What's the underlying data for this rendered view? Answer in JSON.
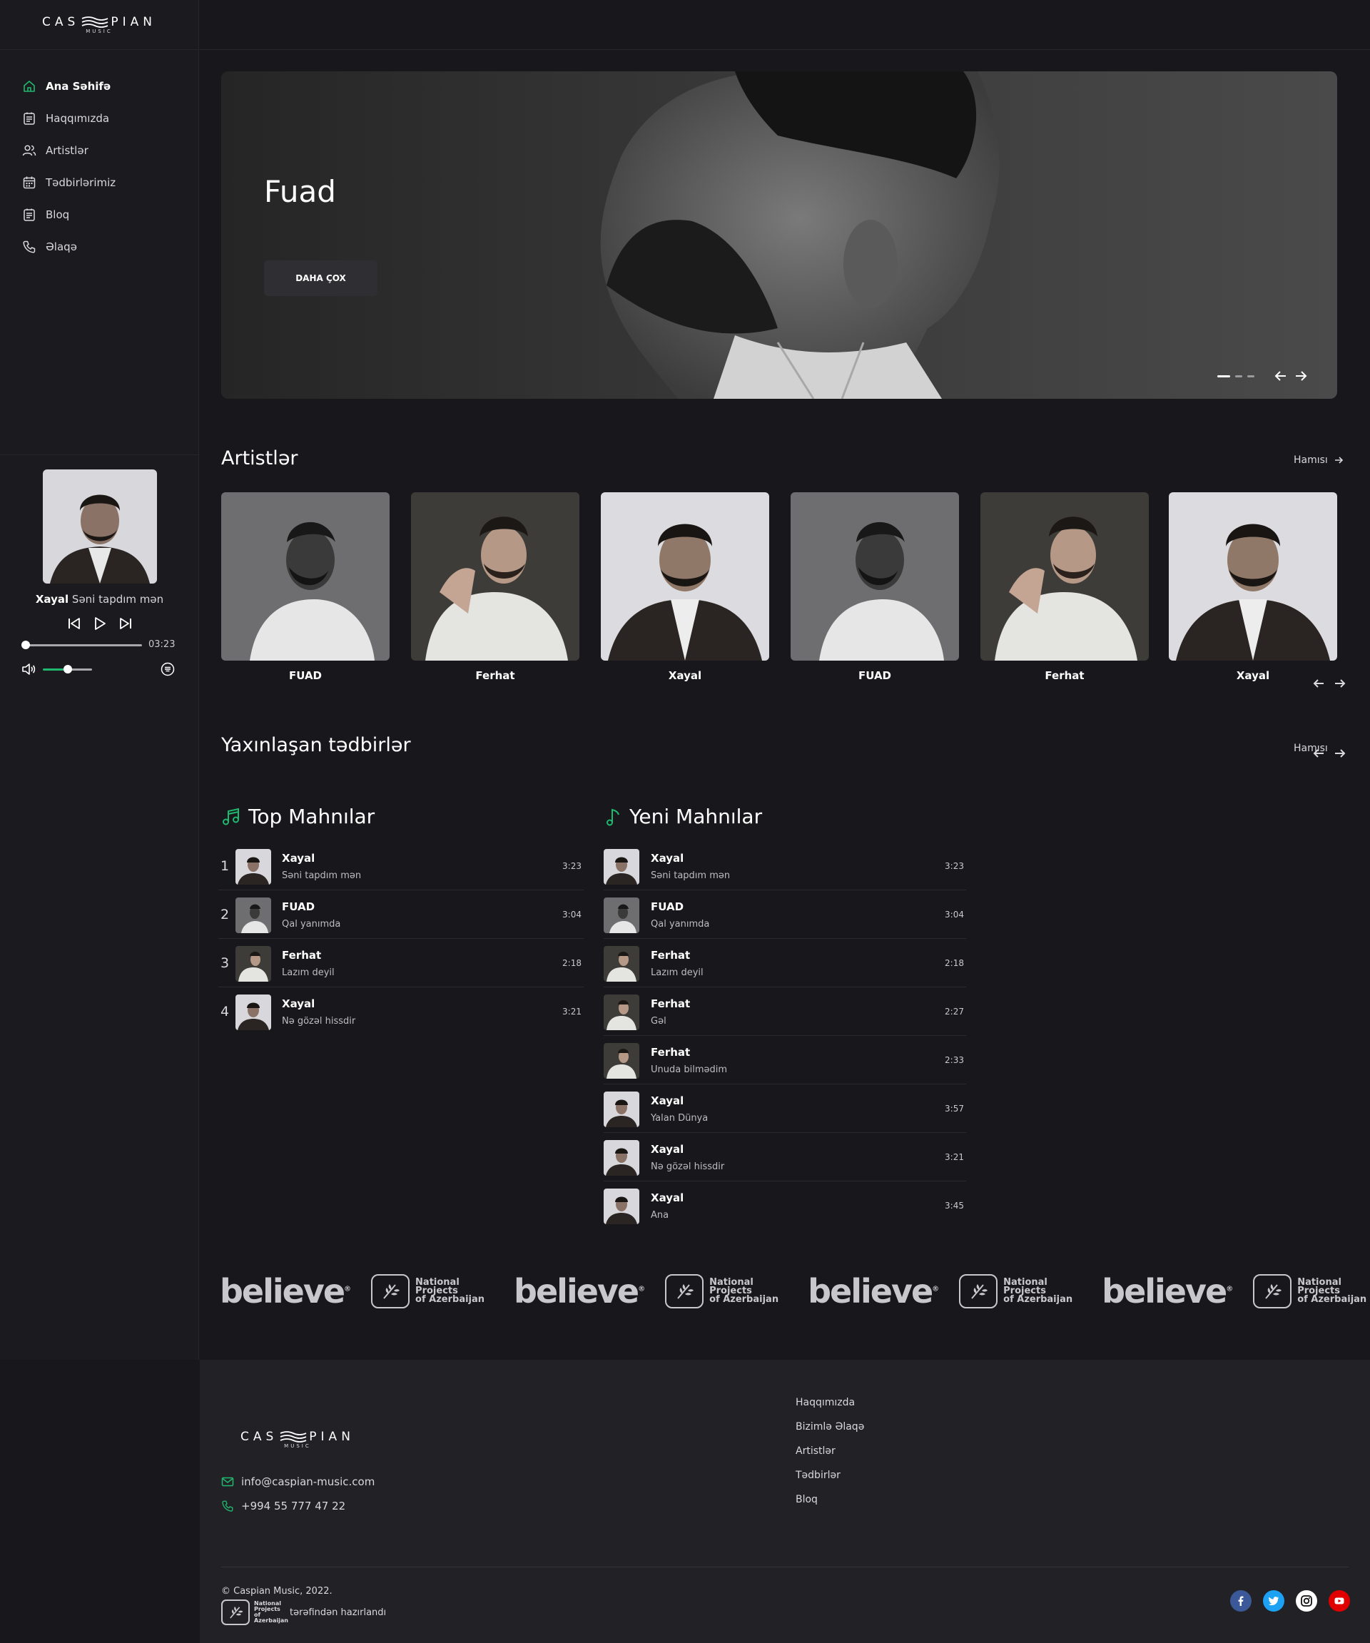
{
  "brand": {
    "logo_left": "CAS",
    "logo_right": "PIAN",
    "logo_sub": "MUSIC"
  },
  "colors": {
    "accent": "#1fb86f",
    "background": "#18181c",
    "sidebar": "#1b1b1f",
    "footer": "#222226"
  },
  "sidebar": {
    "items": [
      {
        "label": "Ana Səhifə",
        "icon": "home-icon",
        "active": true
      },
      {
        "label": "Haqqımızda",
        "icon": "document-icon"
      },
      {
        "label": "Artistlər",
        "icon": "users-icon"
      },
      {
        "label": "Tədbirlərimiz",
        "icon": "calendar-icon"
      },
      {
        "label": "Bloq",
        "icon": "document-icon"
      },
      {
        "label": "Əlaqə",
        "icon": "phone-icon"
      }
    ]
  },
  "player": {
    "artist": "Xayal",
    "track": "Səni tapdım mən",
    "duration": "03:23",
    "progress": 0.0,
    "volume": 0.5
  },
  "hero": {
    "title": "Fuad",
    "button": "DAHA ÇOX",
    "slide_count": 3,
    "active_slide": 1
  },
  "artists": {
    "title": "Artistlər",
    "see_all": "Hamısı",
    "items": [
      {
        "name": "FUAD"
      },
      {
        "name": "Ferhat"
      },
      {
        "name": "Xayal"
      },
      {
        "name": "FUAD"
      },
      {
        "name": "Ferhat"
      },
      {
        "name": "Xayal"
      }
    ]
  },
  "events": {
    "title": "Yaxınlaşan tədbirlər",
    "see_all": "Hamısı"
  },
  "top_songs": {
    "title": "Top Mahnılar",
    "items": [
      {
        "rank": "1",
        "artist": "Xayal",
        "track": "Səni tapdım mən",
        "duration": "3:23"
      },
      {
        "rank": "2",
        "artist": "FUAD",
        "track": "Qal yanımda",
        "duration": "3:04"
      },
      {
        "rank": "3",
        "artist": "Ferhat",
        "track": "Lazım deyil",
        "duration": "2:18"
      },
      {
        "rank": "4",
        "artist": "Xayal",
        "track": "Nə gözəl hissdir",
        "duration": "3:21"
      }
    ]
  },
  "new_songs": {
    "title": "Yeni Mahnılar",
    "items": [
      {
        "artist": "Xayal",
        "track": "Səni tapdım mən",
        "duration": "3:23"
      },
      {
        "artist": "FUAD",
        "track": "Qal yanımda",
        "duration": "3:04"
      },
      {
        "artist": "Ferhat",
        "track": "Lazım deyil",
        "duration": "2:18"
      },
      {
        "artist": "Ferhat",
        "track": "Gəl",
        "duration": "2:27"
      },
      {
        "artist": "Ferhat",
        "track": "Unuda bilmədim",
        "duration": "2:33"
      },
      {
        "artist": "Xayal",
        "track": "Yalan Dünya",
        "duration": "3:57"
      },
      {
        "artist": "Xayal",
        "track": "Nə gözəl hissdir",
        "duration": "3:21"
      },
      {
        "artist": "Xayal",
        "track": "Ana",
        "duration": "3:45"
      }
    ]
  },
  "partners": {
    "believe": "believe",
    "npa_line1": "National Projects",
    "npa_line2": "of Azerbaijan"
  },
  "footer": {
    "email": "info@caspian-music.com",
    "phone": "+994 55 777 47 22",
    "links": [
      "Haqqımızda",
      "Bizimlə Əlaqə",
      "Artistlər",
      "Tədbirlər",
      "Bloq"
    ],
    "copyright": "© Caspian Music, 2022.",
    "credit": "tərəfindən hazırlandı",
    "socials": [
      {
        "icon": "facebook-icon",
        "color": "#3b5998"
      },
      {
        "icon": "twitter-icon",
        "color": "#1da1f2"
      },
      {
        "icon": "instagram-icon",
        "color": "#ffffff"
      },
      {
        "icon": "youtube-icon",
        "color": "#e00000"
      }
    ]
  }
}
